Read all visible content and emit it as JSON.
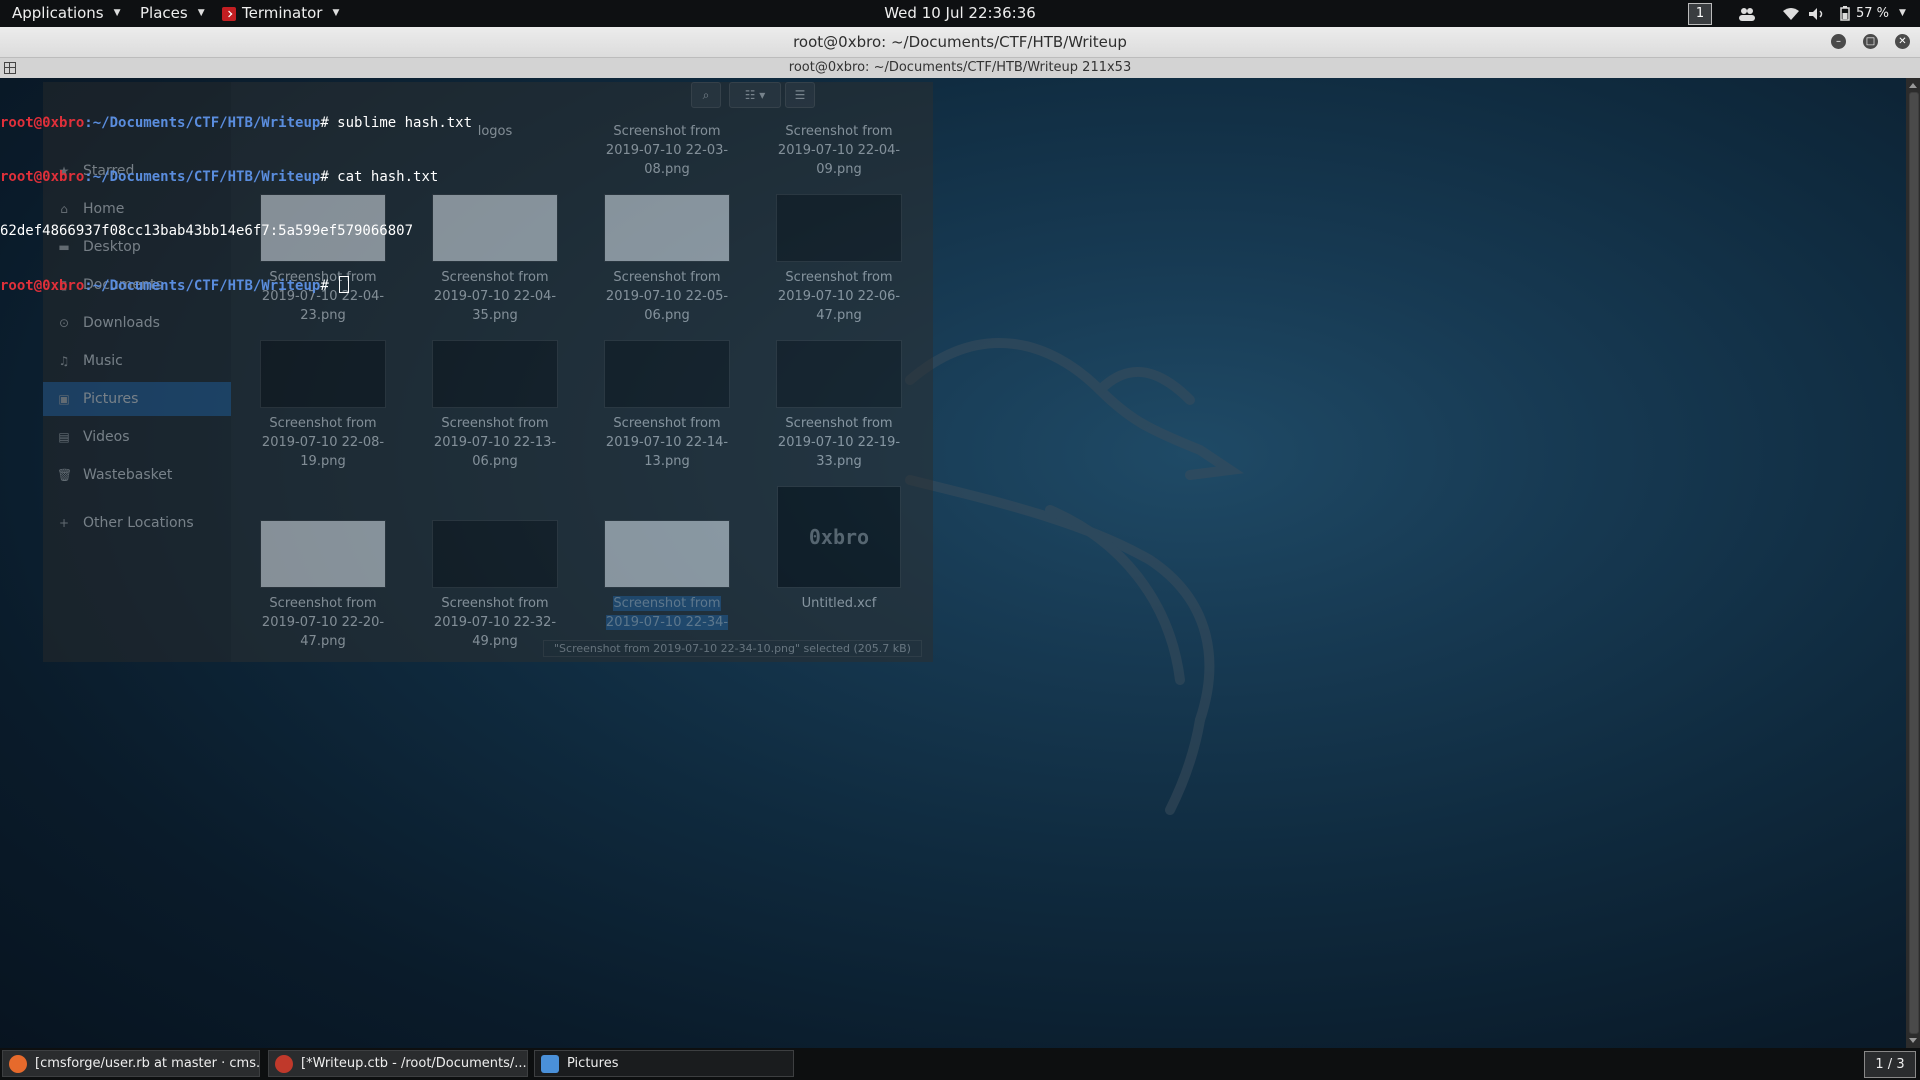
{
  "topbar": {
    "applications": "Applications",
    "places": "Places",
    "terminator": "Terminator",
    "clock": "Wed 10 Jul  22:36:36",
    "workspace": "1",
    "battery": "57 %"
  },
  "window": {
    "title": "root@0xbro: ~/Documents/CTF/HTB/Writeup",
    "term_title": "root@0xbro: ~/Documents/CTF/HTB/Writeup 211x53"
  },
  "terminal": {
    "user": "root@0xbro",
    "path": ":~/Documents/CTF/HTB/Writeup",
    "lines": [
      {
        "type": "prompt",
        "cmd": "# sublime hash.txt"
      },
      {
        "type": "prompt",
        "cmd": "# cat hash.txt"
      },
      {
        "type": "output",
        "text": "62def4866937f08cc13bab43bb14e6f7:5a599ef579066807"
      },
      {
        "type": "prompt",
        "cmd": "# "
      }
    ]
  },
  "files_window": {
    "sidebar": [
      {
        "label": "Starred",
        "icon": "star-icon"
      },
      {
        "label": "Home",
        "icon": "home-icon"
      },
      {
        "label": "Desktop",
        "icon": "desktop-icon"
      },
      {
        "label": "Documents",
        "icon": "document-icon"
      },
      {
        "label": "Downloads",
        "icon": "download-icon"
      },
      {
        "label": "Music",
        "icon": "music-icon"
      },
      {
        "label": "Pictures",
        "icon": "picture-icon",
        "selected": true
      },
      {
        "label": "Videos",
        "icon": "video-icon"
      },
      {
        "label": "Wastebasket",
        "icon": "trash-icon"
      },
      {
        "label": "Other Locations",
        "icon": "plus-icon"
      }
    ],
    "files": [
      {
        "name": "logos"
      },
      {
        "name": "Screenshot from 2019-07-10 22-03-08.png"
      },
      {
        "name": "Screenshot from 2019-07-10 22-04-09.png"
      },
      {
        "name": "Screenshot from 2019-07-10 22-04-23.png"
      },
      {
        "name": "Screenshot from 2019-07-10 22-04-35.png"
      },
      {
        "name": "Screenshot from 2019-07-10 22-05-06.png"
      },
      {
        "name": "Screenshot from 2019-07-10 22-06-47.png"
      },
      {
        "name": "Screenshot from 2019-07-10 22-08-19.png"
      },
      {
        "name": "Screenshot from 2019-07-10 22-13-06.png"
      },
      {
        "name": "Screenshot from 2019-07-10 22-14-13.png"
      },
      {
        "name": "Screenshot from 2019-07-10 22-19-33.png"
      },
      {
        "name": "Screenshot from 2019-07-10 22-20-47.png"
      },
      {
        "name": "Screenshot from 2019-07-10 22-32-49.png"
      },
      {
        "name": "Screenshot from 2019-07-10 22-34-",
        "selected": true
      },
      {
        "name": "Untitled.xcf",
        "thumb_text": "0xbro"
      }
    ],
    "status": "\"Screenshot from 2019-07-10 22-34-10.png\" selected (205.7 kB)"
  },
  "taskbar": {
    "tasks": [
      {
        "label": "[cmsforge/user.rb at master · cms...",
        "icon": "firefox-icon",
        "color": "#e66a2c"
      },
      {
        "label": "[*Writeup.ctb - /root/Documents/...",
        "icon": "cherrytree-icon",
        "color": "#c0392b"
      },
      {
        "label": "Pictures",
        "icon": "folder-icon",
        "color": "#4a90d9"
      }
    ],
    "workspace_indicator": "1 / 3"
  }
}
